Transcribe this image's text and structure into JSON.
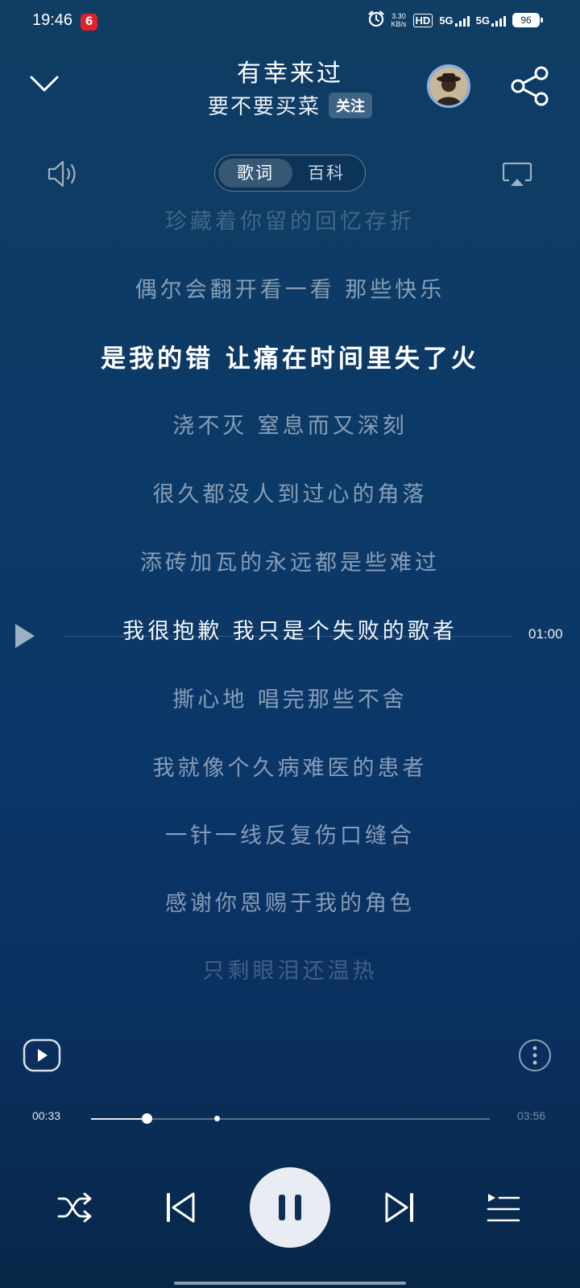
{
  "status_bar": {
    "time": "19:46",
    "app_badge": "6",
    "net_speed_value": "3.30",
    "net_speed_unit": "KB/s",
    "hd_label": "HD",
    "sim1_label": "5G",
    "sim2_label": "5G",
    "battery": "96"
  },
  "header": {
    "title": "有幸来过",
    "artist": "要不要买菜",
    "follow_label": "关注"
  },
  "tabs": [
    {
      "label": "歌词",
      "active": true
    },
    {
      "label": "百科",
      "active": false
    }
  ],
  "lyrics": [
    "珍藏着你留的回忆存折",
    "偶尔会翻开看一看 那些快乐",
    "是我的错 让痛在时间里失了火",
    "浇不灭 窒息而又深刻",
    "很久都没人到过心的角落",
    "添砖加瓦的永远都是些难过",
    "我很抱歉 我只是个失败的歌者",
    "撕心地 唱完那些不舍",
    "我就像个久病难医的患者",
    "一针一线反复伤口缝合",
    "感谢你恩赐于我的角色",
    "只剩眼泪还温热"
  ],
  "lyric_marker_time": "01:00",
  "progress": {
    "current": "00:33",
    "total": "03:56",
    "fraction": 0.14,
    "marker_fraction": 0.315
  },
  "colors": {
    "background_top": "#0f3d63",
    "background_bottom": "#082748",
    "accent": "#ffffff"
  },
  "icons": {
    "collapse": "chevron-down-icon",
    "share": "share-icon",
    "volume": "volume-icon",
    "airplay": "airplay-icon",
    "video": "video-play-icon",
    "more": "more-vertical-icon",
    "shuffle": "shuffle-icon",
    "previous": "skip-previous-icon",
    "pause": "pause-icon",
    "next": "skip-next-icon",
    "playlist": "playlist-icon"
  }
}
